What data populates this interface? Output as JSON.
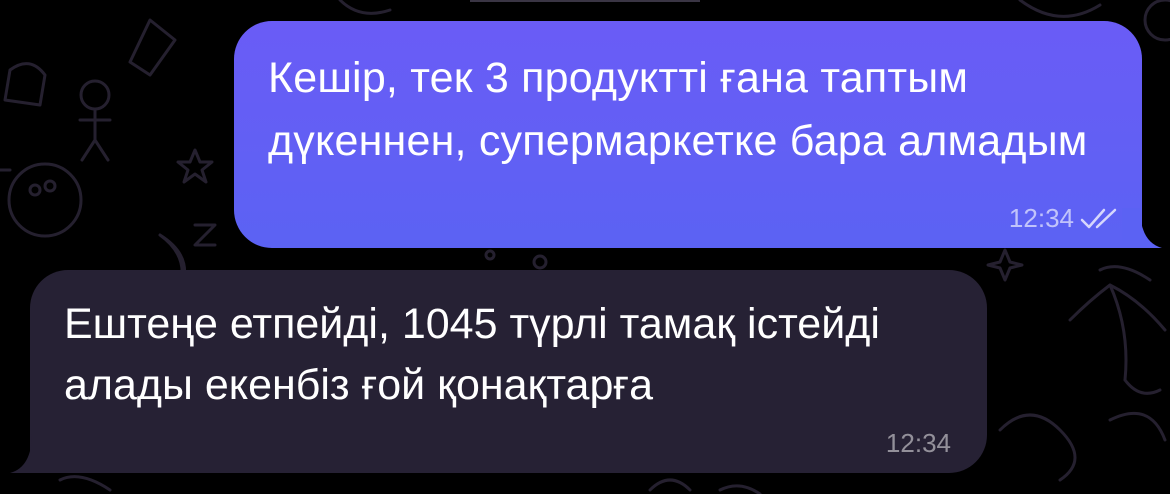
{
  "theme": {
    "background": "#000000",
    "outgoing_bubble": "#5f5ff5",
    "incoming_bubble": "#262134",
    "text": "#ffffff"
  },
  "messages": [
    {
      "direction": "outgoing",
      "text": "Кешір, тек 3 продуктті ғана таптым дүкеннен, супермаркетке бара алмадым",
      "time": "12:34",
      "status_icon": "double-check-icon"
    },
    {
      "direction": "incoming",
      "text": "Ештеңе етпейді, 1045 түрлі тамақ істейді алады екенбіз ғой қонақтарға",
      "time": "12:34"
    }
  ]
}
